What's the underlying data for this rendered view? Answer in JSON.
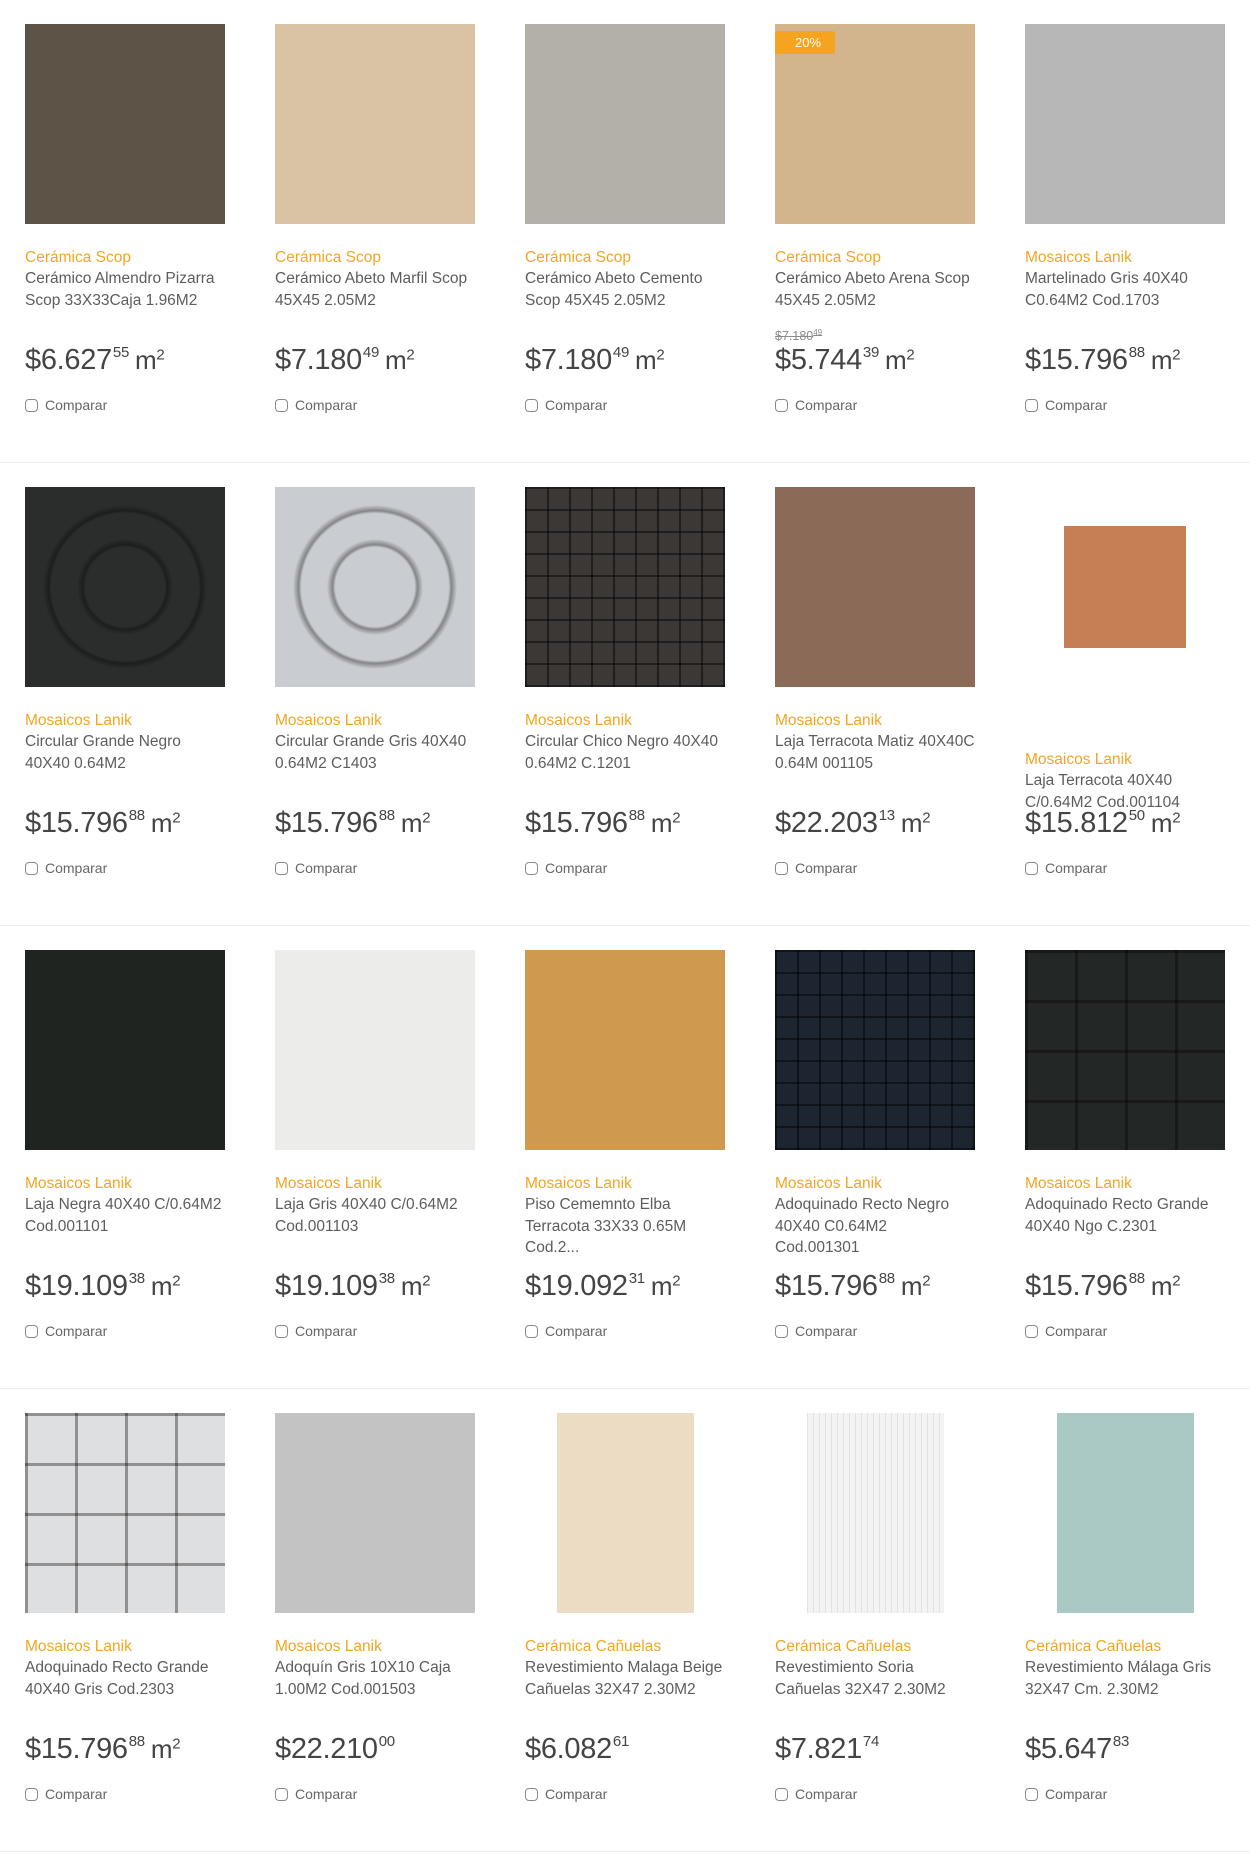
{
  "products": [
    {
      "brand": "Cerámica Scop",
      "name": "Cerámico Almendro Pizarra Scop 33X33Caja 1.96M2",
      "price_int": "$6.627",
      "price_cents": "55",
      "unit": "m",
      "unit_exp": "2",
      "compare": "Comparar",
      "swatch": "#5e5347",
      "pattern": "plain",
      "img_w": 200,
      "img_h": 200
    },
    {
      "brand": "Cerámica Scop",
      "name": "Cerámico Abeto Marfil Scop 45X45 2.05M2",
      "price_int": "$7.180",
      "price_cents": "49",
      "unit": "m",
      "unit_exp": "2",
      "compare": "Comparar",
      "swatch": "#d9c3a4",
      "pattern": "plain",
      "img_w": 200,
      "img_h": 200
    },
    {
      "brand": "Cerámica Scop",
      "name": "Cerámico Abeto Cemento Scop 45X45 2.05M2",
      "price_int": "$7.180",
      "price_cents": "49",
      "unit": "m",
      "unit_exp": "2",
      "compare": "Comparar",
      "swatch": "#b2b0a8",
      "pattern": "plain",
      "img_w": 200,
      "img_h": 200
    },
    {
      "brand": "Cerámica Scop",
      "name": "Cerámico Abeto Arena Scop 45X45 2.05M2",
      "discount": "20%",
      "old_price_int": "$7.180",
      "old_price_cents": "49",
      "price_int": "$5.744",
      "price_cents": "39",
      "unit": "m",
      "unit_exp": "2",
      "compare": "Comparar",
      "swatch": "#d2b58d",
      "pattern": "plain",
      "img_w": 200,
      "img_h": 200
    },
    {
      "brand": "Mosaicos Lanik",
      "name": "Martelinado Gris 40X40 C0.64M2 Cod.1703",
      "price_int": "$15.796",
      "price_cents": "88",
      "unit": "m",
      "unit_exp": "2",
      "compare": "Comparar",
      "swatch": "#b7b7b7",
      "pattern": "plain",
      "img_w": 200,
      "img_h": 200
    },
    {
      "brand": "Mosaicos Lanik",
      "name": "Circular Grande Negro 40X40 0.64M2",
      "price_int": "$15.796",
      "price_cents": "88",
      "unit": "m",
      "unit_exp": "2",
      "compare": "Comparar",
      "swatch": "#2b2d2c",
      "pattern": "stones",
      "img_w": 200,
      "img_h": 200
    },
    {
      "brand": "Mosaicos Lanik",
      "name": "Circular Grande Gris 40X40 0.64M2 C1403",
      "price_int": "$15.796",
      "price_cents": "88",
      "unit": "m",
      "unit_exp": "2",
      "compare": "Comparar",
      "swatch": "#c9ccd0",
      "pattern": "stones",
      "img_w": 200,
      "img_h": 200
    },
    {
      "brand": "Mosaicos Lanik",
      "name": "Circular Chico Negro 40X40 0.64M2 C.1201",
      "price_int": "$15.796",
      "price_cents": "88",
      "unit": "m",
      "unit_exp": "2",
      "compare": "Comparar",
      "swatch": "#3b3836",
      "pattern": "grid",
      "img_w": 200,
      "img_h": 200
    },
    {
      "brand": "Mosaicos Lanik",
      "name": "Laja Terracota Matiz 40X40C 0.64M 001105",
      "price_int": "$22.203",
      "price_cents": "13",
      "unit": "m",
      "unit_exp": "2",
      "compare": "Comparar",
      "swatch": "#8b6a57",
      "pattern": "plain",
      "img_w": 200,
      "img_h": 200
    },
    {
      "brand": "Mosaicos Lanik",
      "name": "Laja Terracota 40X40 C/0.64M2 Cod.001104",
      "price_int": "$15.812",
      "price_cents": "50",
      "unit": "m",
      "unit_exp": "2",
      "compare": "Comparar",
      "swatch": "#c67f55",
      "pattern": "plain",
      "img_w": 122,
      "img_h": 122
    },
    {
      "brand": "Mosaicos Lanik",
      "name": "Laja Negra 40X40 C/0.64M2 Cod.001101",
      "price_int": "$19.109",
      "price_cents": "38",
      "unit": "m",
      "unit_exp": "2",
      "compare": "Comparar",
      "swatch": "#1f2421",
      "pattern": "plain",
      "img_w": 200,
      "img_h": 200
    },
    {
      "brand": "Mosaicos Lanik",
      "name": "Laja Gris 40X40 C/0.64M2 Cod.001103",
      "price_int": "$19.109",
      "price_cents": "38",
      "unit": "m",
      "unit_exp": "2",
      "compare": "Comparar",
      "swatch": "#ececea",
      "pattern": "plain",
      "img_w": 200,
      "img_h": 200
    },
    {
      "brand": "Mosaicos Lanik",
      "name": "Piso Cememnto Elba Terracota 33X33 0.65M Cod.2...",
      "price_int": "$19.092",
      "price_cents": "31",
      "unit": "m",
      "unit_exp": "2",
      "compare": "Comparar",
      "swatch": "#cf9a50",
      "pattern": "plain",
      "img_w": 200,
      "img_h": 200
    },
    {
      "brand": "Mosaicos Lanik",
      "name": "Adoquinado Recto Negro 40X40 C0.64M2 Cod.001301",
      "price_int": "$15.796",
      "price_cents": "88",
      "unit": "m",
      "unit_exp": "2",
      "compare": "Comparar",
      "swatch": "#1c2530",
      "pattern": "grid",
      "img_w": 200,
      "img_h": 200
    },
    {
      "brand": "Mosaicos Lanik",
      "name": "Adoquinado Recto Grande 40X40 Ngo C.2301",
      "price_int": "$15.796",
      "price_cents": "88",
      "unit": "m",
      "unit_exp": "2",
      "compare": "Comparar",
      "swatch": "#232826",
      "pattern": "grid4",
      "img_w": 200,
      "img_h": 200
    },
    {
      "brand": "Mosaicos Lanik",
      "name": "Adoquinado Recto Grande 40X40 Gris Cod.2303",
      "price_int": "$15.796",
      "price_cents": "88",
      "unit": "m",
      "unit_exp": "2",
      "compare": "Comparar",
      "swatch": "#dedfe1",
      "pattern": "grid4",
      "img_w": 200,
      "img_h": 200
    },
    {
      "brand": "Mosaicos Lanik",
      "name": "Adoquín Gris 10X10 Caja 1.00M2 Cod.001503",
      "price_int": "$22.210",
      "price_cents": "00",
      "unit": "",
      "unit_exp": "",
      "compare": "Comparar",
      "swatch": "#c3c3c3",
      "pattern": "plain",
      "img_w": 200,
      "img_h": 200
    },
    {
      "brand": "Cerámica Cañuelas",
      "name": "Revestimiento Malaga Beige Cañuelas 32X47 2.30M2",
      "price_int": "$6.082",
      "price_cents": "61",
      "unit": "",
      "unit_exp": "",
      "compare": "Comparar",
      "swatch": "#eddcc4",
      "pattern": "plain",
      "img_w": 137,
      "img_h": 200
    },
    {
      "brand": "Cerámica Cañuelas",
      "name": "Revestimiento Soria Cañuelas 32X47 2.30M2",
      "price_int": "$7.821",
      "price_cents": "74",
      "unit": "",
      "unit_exp": "",
      "compare": "Comparar",
      "swatch": "#f3f3f3",
      "pattern": "stripes",
      "img_w": 137,
      "img_h": 200
    },
    {
      "brand": "Cerámica Cañuelas",
      "name": "Revestimiento Málaga Gris 32X47 Cm. 2.30M2",
      "price_int": "$5.647",
      "price_cents": "83",
      "unit": "",
      "unit_exp": "",
      "compare": "Comparar",
      "swatch": "#aac9c4",
      "pattern": "plain",
      "img_w": 137,
      "img_h": 200
    }
  ]
}
